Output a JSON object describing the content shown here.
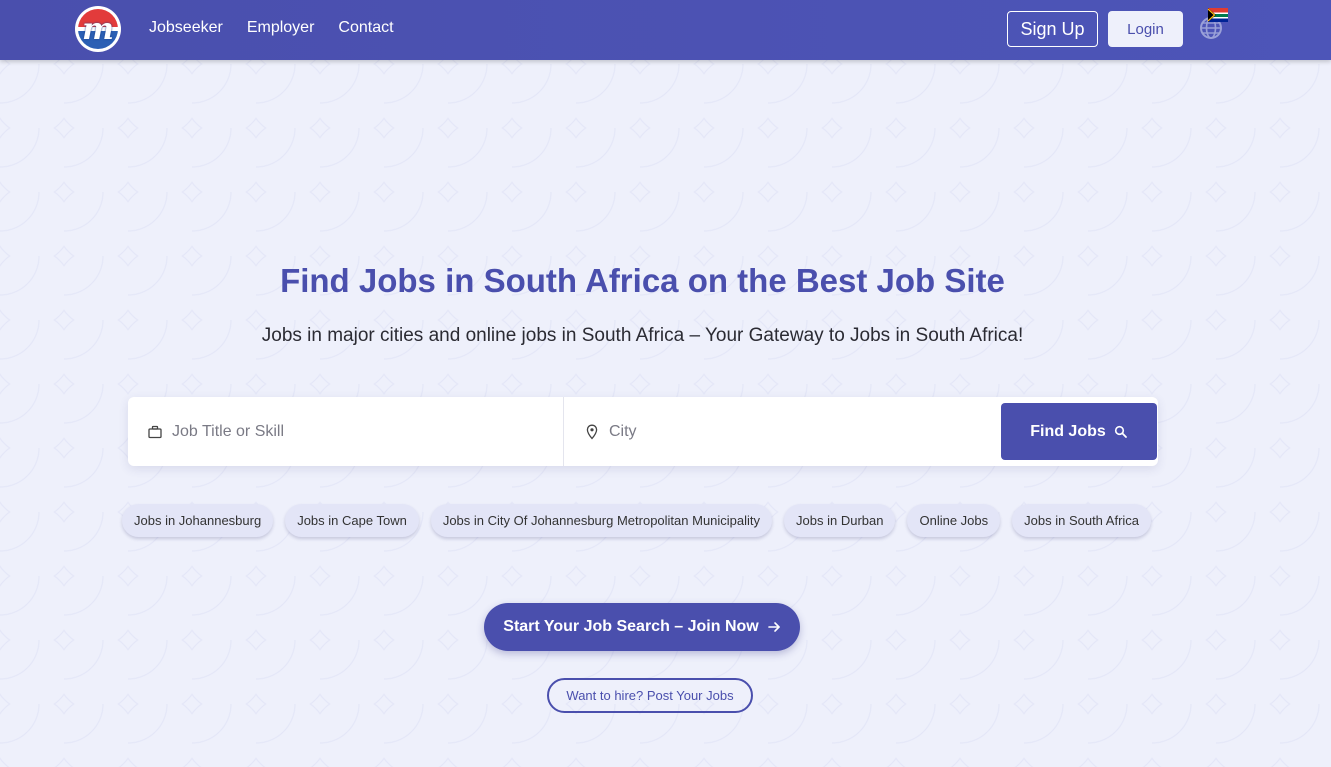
{
  "nav": {
    "logo_letter": "m",
    "links": [
      "Jobseeker",
      "Employer",
      "Contact"
    ],
    "signup_label": "Sign Up",
    "login_label": "Login",
    "language_icon": "globe-with-south-africa-flag"
  },
  "hero": {
    "title": "Find Jobs in South Africa on the Best Job Site",
    "subtitle": "Jobs in major cities and online jobs in South Africa – Your Gateway to Jobs in South Africa!"
  },
  "search": {
    "job_placeholder": "Job Title or Skill",
    "job_value": "",
    "city_placeholder": "City",
    "city_value": "",
    "button_label": "Find Jobs"
  },
  "tags": [
    "Jobs in Johannesburg",
    "Jobs in Cape Town",
    "Jobs in City Of Johannesburg Metropolitan Municipality",
    "Jobs in Durban",
    "Online Jobs",
    "Jobs in South Africa"
  ],
  "cta": {
    "join_label": "Start Your Job Search – Join Now",
    "hire_label": "Want to hire? Post Your Jobs"
  },
  "colors": {
    "primary": "#4a4fad",
    "background": "#eef0fb",
    "tag_bg": "#e3e5f7"
  }
}
